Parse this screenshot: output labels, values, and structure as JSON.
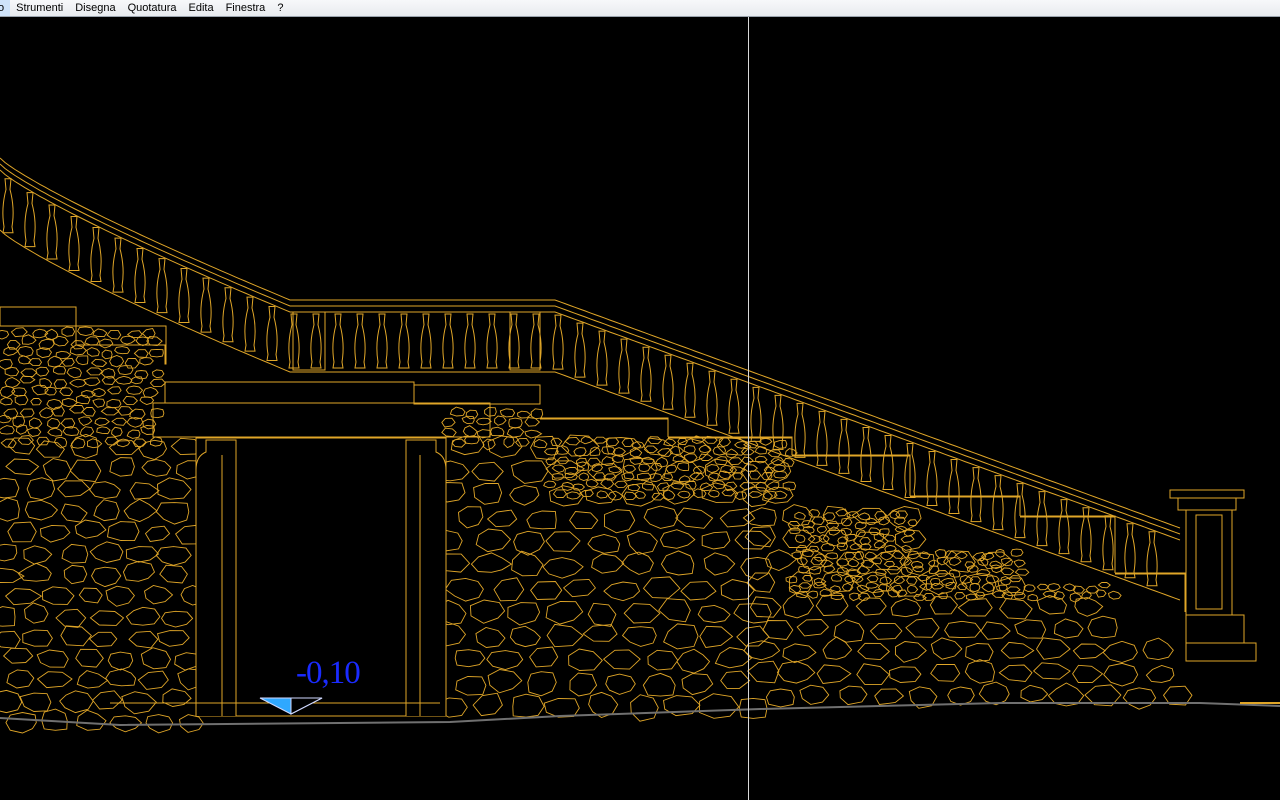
{
  "menubar": {
    "items": [
      {
        "label": "o"
      },
      {
        "label": "Strumenti"
      },
      {
        "label": "Disegna"
      },
      {
        "label": "Quotatura"
      },
      {
        "label": "Edita"
      },
      {
        "label": "Finestra"
      },
      {
        "label": "?"
      }
    ]
  },
  "drawing": {
    "level_marker": {
      "label": "-0,10"
    },
    "colors": {
      "background": "#000000",
      "lines": "#e0a628",
      "level_text": "#1a2bff",
      "level_marker_fill": "#2fa8ff",
      "ground": "#707070",
      "cursor": "#d8d8d8"
    }
  }
}
